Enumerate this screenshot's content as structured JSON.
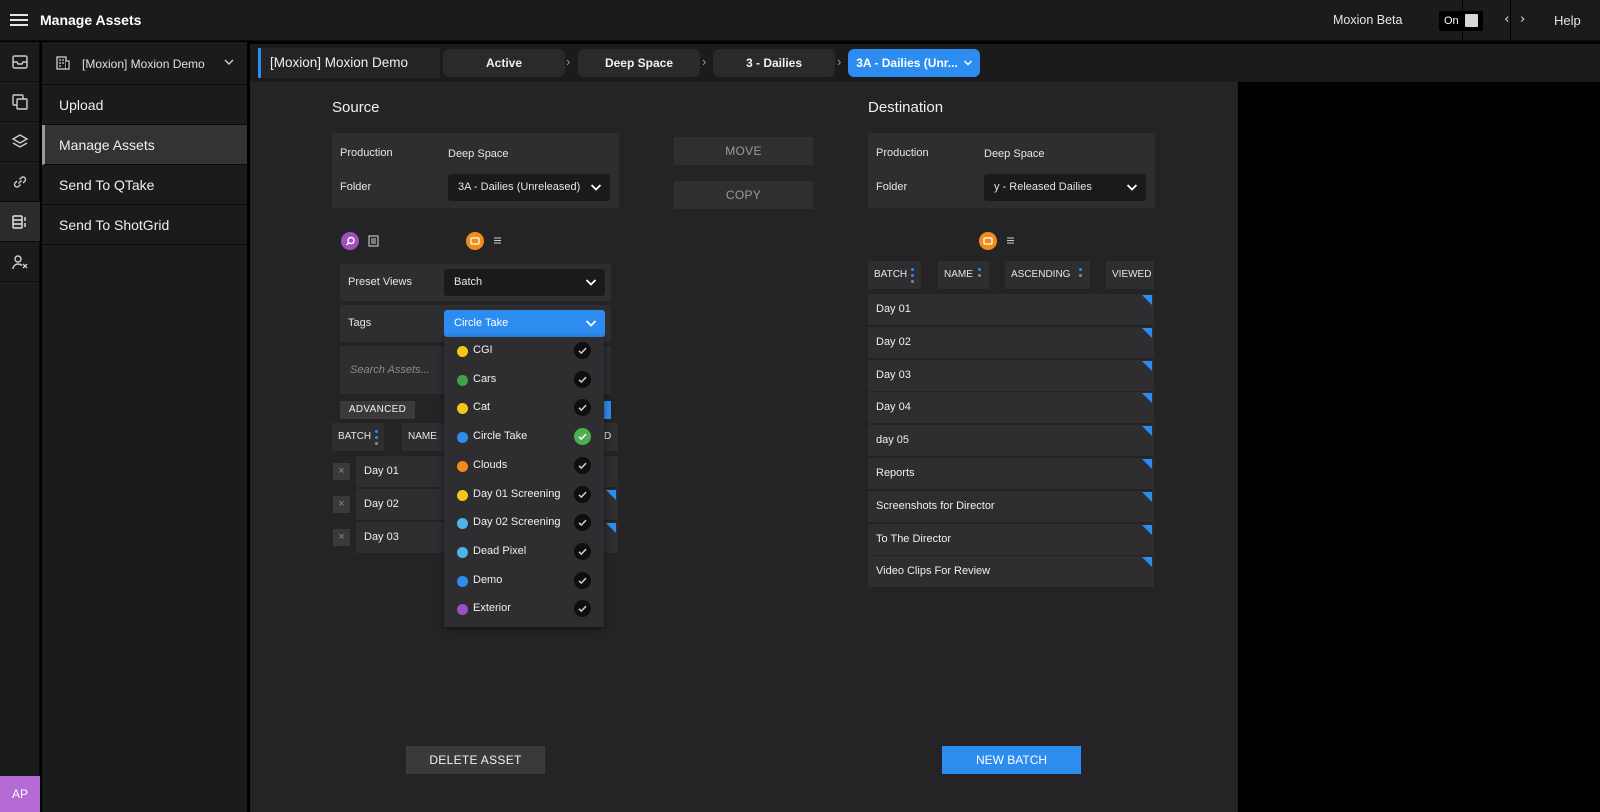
{
  "app": {
    "title": "Manage Assets",
    "beta_label": "Moxion Beta",
    "toggle_label": "On",
    "code_glyph": "‹ ›",
    "help": "Help"
  },
  "rail": {
    "avatar": "AP"
  },
  "nav": {
    "project": "[Moxion] Moxion Demo",
    "items": [
      {
        "label": "Upload"
      },
      {
        "label": "Manage Assets"
      },
      {
        "label": "Send To QTake"
      },
      {
        "label": "Send To ShotGrid"
      }
    ]
  },
  "breadcrumb": {
    "root": "[Moxion] Moxion Demo",
    "items": [
      {
        "label": "Active"
      },
      {
        "label": "Deep Space"
      },
      {
        "label": "3 - Dailies"
      },
      {
        "label": "3A - Dailies (Unr..."
      }
    ]
  },
  "source": {
    "title": "Source",
    "production_label": "Production",
    "production_value": "Deep Space",
    "folder_label": "Folder",
    "folder_value": "3A - Dailies (Unreleased)",
    "preset_label": "Preset Views",
    "preset_value": "Batch",
    "tags_label": "Tags",
    "tags_value": "Circle Take",
    "search_placeholder": "Search Assets...",
    "advanced": "ADVANCED",
    "headers": {
      "batch": "BATCH",
      "name": "NAME",
      "partial": "D"
    },
    "rows": [
      "Day 01",
      "Day 02",
      "Day 03"
    ],
    "row_close": "×"
  },
  "actions": {
    "move": "MOVE",
    "copy": "COPY"
  },
  "destination": {
    "title": "Destination",
    "production_label": "Production",
    "production_value": "Deep Space",
    "folder_label": "Folder",
    "folder_value": "y - Released Dailies",
    "headers": {
      "batch": "BATCH",
      "name": "NAME",
      "ascending": "ASCENDING",
      "viewed": "VIEWED"
    },
    "rows": [
      "Day 01",
      "Day 02",
      "Day 03",
      "Day 04",
      "day 05",
      "Reports",
      "Screenshots for Director",
      "To The Director",
      "Video Clips For Review"
    ]
  },
  "tags": [
    {
      "name": "CGI",
      "color": "#f5c518",
      "checked": false
    },
    {
      "name": "Cars",
      "color": "#43a047",
      "checked": false
    },
    {
      "name": "Cat",
      "color": "#f5c518",
      "checked": false
    },
    {
      "name": "Circle Take",
      "color": "#2d8cf0",
      "checked": true
    },
    {
      "name": "Clouds",
      "color": "#f08c1a",
      "checked": false
    },
    {
      "name": "Day 01 Screening",
      "color": "#f5c518",
      "checked": false
    },
    {
      "name": "Day 02 Screening",
      "color": "#4fb3e8",
      "checked": false
    },
    {
      "name": "Dead Pixel",
      "color": "#4fb3e8",
      "checked": false
    },
    {
      "name": "Demo",
      "color": "#2d8cf0",
      "checked": false
    },
    {
      "name": "Exterior",
      "color": "#a04fc0",
      "checked": false
    }
  ],
  "footer": {
    "delete": "DELETE ASSET",
    "new_batch": "NEW BATCH"
  },
  "colors": {
    "accent": "#2d8cf0",
    "search_icon": "#a04fc0",
    "view_icon": "#f08c1a",
    "avatar": "#b66ad6",
    "check_on": "#4caf50"
  }
}
